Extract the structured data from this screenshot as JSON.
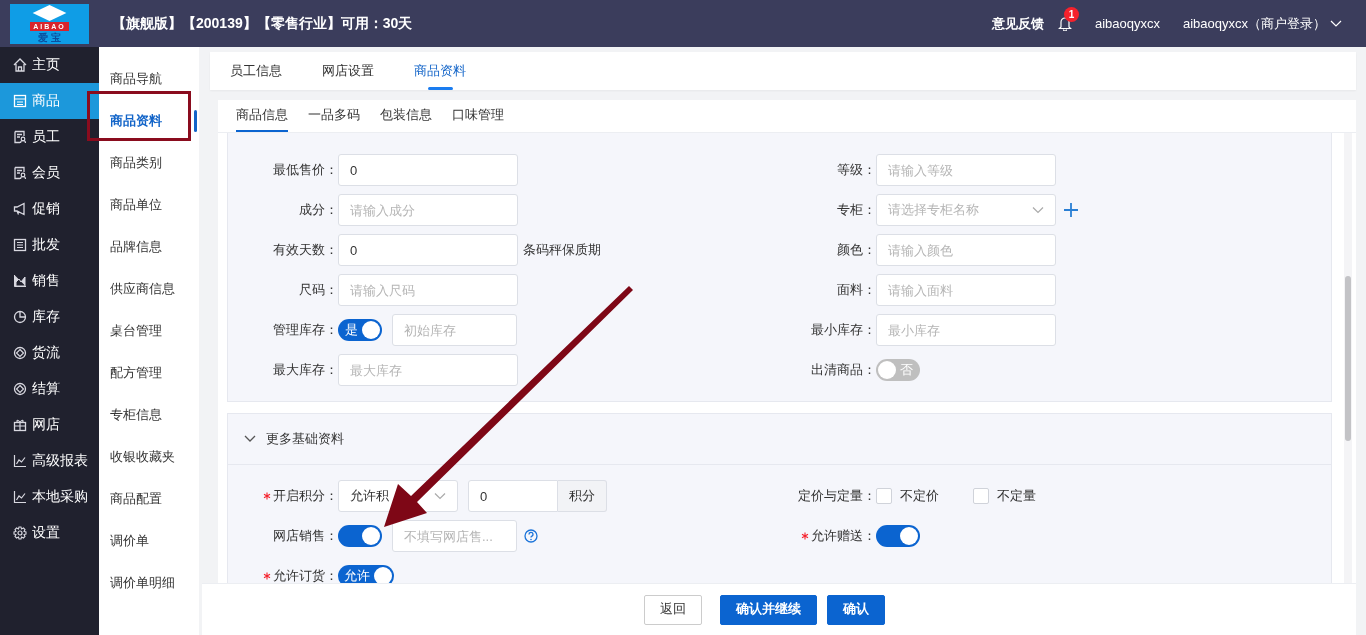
{
  "logo": {
    "brand": "AIBAO",
    "caption": "爱 宝"
  },
  "header": {
    "title": "【旗舰版】【200139】【零售行业】可用：30天",
    "feedback": "意见反馈",
    "notifications": "1",
    "user": "aibaoqyxcx",
    "account": "aibaoqyxcx（商户登录）"
  },
  "sidebar": {
    "items": [
      {
        "label": "主页",
        "selected": false
      },
      {
        "label": "商品",
        "selected": true
      },
      {
        "label": "员工",
        "selected": false
      },
      {
        "label": "会员",
        "selected": false
      },
      {
        "label": "促销",
        "selected": false
      },
      {
        "label": "批发",
        "selected": false
      },
      {
        "label": "销售",
        "selected": false
      },
      {
        "label": "库存",
        "selected": false
      },
      {
        "label": "货流",
        "selected": false
      },
      {
        "label": "结算",
        "selected": false
      },
      {
        "label": "网店",
        "selected": false
      },
      {
        "label": "高级报表",
        "selected": false
      },
      {
        "label": "本地采购",
        "selected": false
      },
      {
        "label": "设置",
        "selected": false
      }
    ]
  },
  "subnav": {
    "items": [
      {
        "label": "商品导航",
        "selected": false
      },
      {
        "label": "商品资料",
        "selected": true
      },
      {
        "label": "商品类别",
        "selected": false
      },
      {
        "label": "商品单位",
        "selected": false
      },
      {
        "label": "品牌信息",
        "selected": false
      },
      {
        "label": "供应商信息",
        "selected": false
      },
      {
        "label": "桌台管理",
        "selected": false
      },
      {
        "label": "配方管理",
        "selected": false
      },
      {
        "label": "专柜信息",
        "selected": false
      },
      {
        "label": "收银收藏夹",
        "selected": false
      },
      {
        "label": "商品配置",
        "selected": false
      },
      {
        "label": "调价单",
        "selected": false
      },
      {
        "label": "调价单明细",
        "selected": false
      }
    ]
  },
  "tabs": [
    {
      "label": "员工信息",
      "selected": false
    },
    {
      "label": "网店设置",
      "selected": false
    },
    {
      "label": "商品资料",
      "selected": true
    }
  ],
  "subtabs": [
    {
      "label": "商品信息",
      "selected": true
    },
    {
      "label": "一品多码",
      "selected": false
    },
    {
      "label": "包装信息",
      "selected": false
    },
    {
      "label": "口味管理",
      "selected": false
    }
  ],
  "basic_form": {
    "rows": [
      {
        "left": {
          "label": "最低售价：",
          "required": false,
          "controls": [
            {
              "kind": "input",
              "value": "0"
            }
          ]
        },
        "right": {
          "label": "等级：",
          "required": false,
          "controls": [
            {
              "kind": "input",
              "placeholder": "请输入等级"
            }
          ]
        }
      },
      {
        "left": {
          "label": "成分：",
          "required": false,
          "controls": [
            {
              "kind": "input",
              "placeholder": "请输入成分"
            }
          ]
        },
        "right": {
          "label": "专柜：",
          "required": false,
          "controls": [
            {
              "kind": "select",
              "placeholder": "请选择专柜名称"
            },
            {
              "kind": "add"
            }
          ]
        }
      },
      {
        "left": {
          "label": "有效天数：",
          "required": false,
          "controls": [
            {
              "kind": "input",
              "value": "0"
            },
            {
              "kind": "text",
              "text": "条码秤保质期"
            }
          ]
        },
        "right": {
          "label": "颜色：",
          "required": false,
          "controls": [
            {
              "kind": "input",
              "placeholder": "请输入颜色"
            }
          ]
        }
      },
      {
        "left": {
          "label": "尺码：",
          "required": false,
          "controls": [
            {
              "kind": "input",
              "placeholder": "请输入尺码"
            }
          ]
        },
        "right": {
          "label": "面料：",
          "required": false,
          "controls": [
            {
              "kind": "input",
              "placeholder": "请输入面料"
            }
          ]
        }
      },
      {
        "left": {
          "label": "管理库存：",
          "required": false,
          "controls": [
            {
              "kind": "switch",
              "on": true,
              "text": "是"
            },
            {
              "kind": "input",
              "placeholder": "初始库存"
            }
          ]
        },
        "right": {
          "label": "最小库存：",
          "required": false,
          "controls": [
            {
              "kind": "input",
              "placeholder": "最小库存"
            }
          ]
        }
      },
      {
        "left": {
          "label": "最大库存：",
          "required": false,
          "controls": [
            {
              "kind": "input",
              "placeholder": "最大库存"
            }
          ]
        },
        "right": {
          "label": "出清商品：",
          "required": false,
          "controls": [
            {
              "kind": "switch",
              "on": false,
              "text": "否"
            }
          ]
        }
      }
    ]
  },
  "more_section": {
    "title": "更多基础资料",
    "expanded": true,
    "rows": [
      {
        "left": {
          "label": "开启积分：",
          "required": true,
          "controls": [
            {
              "kind": "select",
              "value": "允许积"
            },
            {
              "kind": "input",
              "value": "0"
            },
            {
              "kind": "addon",
              "text": "积分"
            }
          ]
        },
        "right": {
          "label": "定价与定量：",
          "required": false,
          "controls": [
            {
              "kind": "checkbox",
              "checked": false,
              "text": "不定价"
            },
            {
              "kind": "checkbox",
              "checked": false,
              "text": "不定量"
            }
          ]
        }
      },
      {
        "left": {
          "label": "网店销售：",
          "required": false,
          "controls": [
            {
              "kind": "switch",
              "on": true
            },
            {
              "kind": "input",
              "placeholder": "不填写网店售..."
            },
            {
              "kind": "help"
            }
          ]
        },
        "right": {
          "label": "允许赠送：",
          "required": true,
          "controls": [
            {
              "kind": "switch",
              "on": true
            }
          ]
        }
      },
      {
        "left": {
          "label": "允许订货：",
          "required": true,
          "controls": [
            {
              "kind": "switch",
              "on": true,
              "text": "允许"
            }
          ]
        }
      }
    ]
  },
  "footer": {
    "buttons": [
      {
        "label": "返回",
        "kind": "default"
      },
      {
        "label": "确认并继续",
        "kind": "primary"
      },
      {
        "label": "确认",
        "kind": "primary"
      }
    ]
  }
}
